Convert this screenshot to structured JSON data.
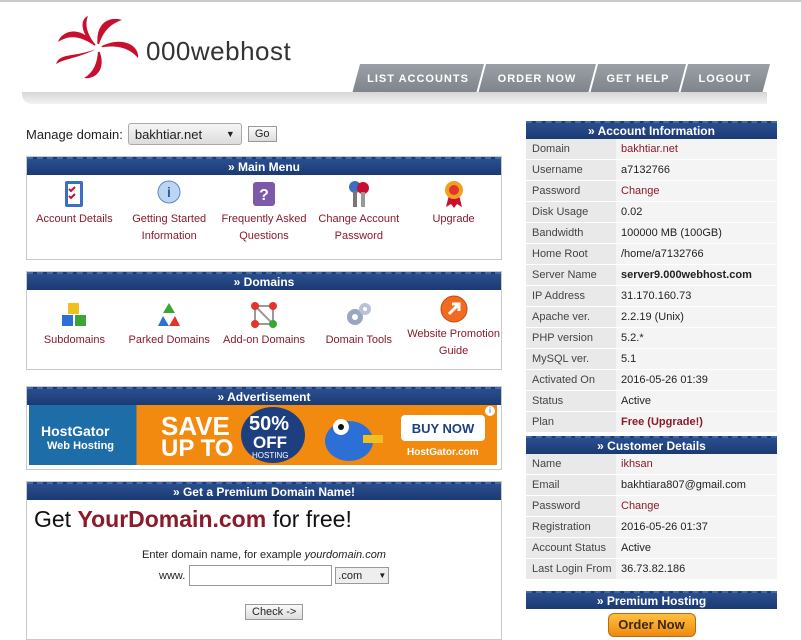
{
  "brand": {
    "name": "000webhost"
  },
  "nav": [
    {
      "label": "LIST ACCOUNTS"
    },
    {
      "label": "ORDER NOW"
    },
    {
      "label": "GET HELP"
    },
    {
      "label": "LOGOUT"
    }
  ],
  "manage": {
    "label": "Manage domain:",
    "selected": "bakhtiar.net",
    "go": "Go"
  },
  "main_menu": {
    "title": "»  Main Menu",
    "items": [
      {
        "label1": "Account Details",
        "label2": "",
        "icon": "checklist-icon"
      },
      {
        "label1": "Getting Started",
        "label2": "Information",
        "icon": "info-icon"
      },
      {
        "label1": "Frequently Asked",
        "label2": "Questions",
        "icon": "question-icon"
      },
      {
        "label1": "Change Account",
        "label2": "Password",
        "icon": "keys-icon"
      },
      {
        "label1": "Upgrade",
        "label2": "",
        "icon": "ribbon-icon"
      }
    ]
  },
  "domains": {
    "title": "»  Domains",
    "items": [
      {
        "label1": "Subdomains",
        "label2": "",
        "icon": "cubes-icon"
      },
      {
        "label1": "Parked Domains",
        "label2": "",
        "icon": "recycle-icon"
      },
      {
        "label1": "Add-on Domains",
        "label2": "",
        "icon": "network-icon"
      },
      {
        "label1": "Domain Tools",
        "label2": "",
        "icon": "gears-icon"
      },
      {
        "label1": "Website Promotion",
        "label2": "Guide",
        "icon": "arrow-icon"
      }
    ]
  },
  "advert": {
    "title": "»  Advertisement",
    "brand1": "HostGator",
    "brand2": "Web Hosting",
    "save1": "SAVE",
    "save2": "UP TO",
    "pct": "50%",
    "off": "OFF",
    "hosting": "HOSTING",
    "buy": "BUY NOW",
    "site": "HostGator.com"
  },
  "premium_domain": {
    "title": "»  Get a Premium Domain Name!",
    "pre": "Get ",
    "brand": "YourDomain.com",
    "post": " for free!",
    "prompt": "Enter domain name, for example ",
    "example": "yourdomain.com",
    "www": "www.",
    "tld": ".com",
    "check": "Check ->"
  },
  "account": {
    "title": "» Account Information",
    "rows": [
      {
        "k": "Domain",
        "v": "bakhtiar.net",
        "cls": "red"
      },
      {
        "k": "Username",
        "v": "a7132766",
        "cls": ""
      },
      {
        "k": "Password",
        "v": "Change",
        "cls": "red"
      },
      {
        "k": "Disk Usage",
        "v": "0.02",
        "cls": ""
      },
      {
        "k": "Bandwidth",
        "v": "100000 MB (100GB)",
        "cls": ""
      },
      {
        "k": "Home Root",
        "v": "/home/a7132766",
        "cls": ""
      },
      {
        "k": "Server Name",
        "v": "server9.000webhost.com",
        "cls": "bold"
      },
      {
        "k": "IP Address",
        "v": "31.170.160.73",
        "cls": ""
      },
      {
        "k": "Apache ver.",
        "v": "2.2.19 (Unix)",
        "cls": ""
      },
      {
        "k": "PHP version",
        "v": "5.2.*",
        "cls": ""
      },
      {
        "k": "MySQL ver.",
        "v": "5.1",
        "cls": ""
      },
      {
        "k": "Activated On",
        "v": "2016-05-26 01:39",
        "cls": ""
      },
      {
        "k": "Status",
        "v": "Active",
        "cls": ""
      },
      {
        "k": "Plan",
        "v": "Free (Upgrade!)",
        "cls": "redbold"
      }
    ]
  },
  "customer": {
    "title": "» Customer Details",
    "rows": [
      {
        "k": "Name",
        "v": "ikhsan",
        "cls": "red"
      },
      {
        "k": "Email",
        "v": "bakhtiara807@gmail.com",
        "cls": ""
      },
      {
        "k": "Password",
        "v": "Change",
        "cls": "red"
      },
      {
        "k": "Registration",
        "v": "2016-05-26 01:37",
        "cls": ""
      },
      {
        "k": "Account Status",
        "v": "Active",
        "cls": ""
      },
      {
        "k": "Last Login From",
        "v": "36.73.82.186",
        "cls": ""
      }
    ]
  },
  "premium_hosting": {
    "title": "» Premium Hosting",
    "order": "Order Now"
  }
}
